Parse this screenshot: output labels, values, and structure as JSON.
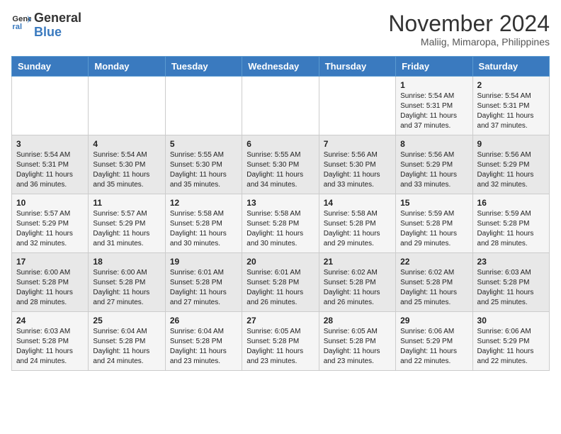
{
  "header": {
    "logo_general": "General",
    "logo_blue": "Blue",
    "month_year": "November 2024",
    "location": "Maliig, Mimaropa, Philippines"
  },
  "calendar": {
    "days_of_week": [
      "Sunday",
      "Monday",
      "Tuesday",
      "Wednesday",
      "Thursday",
      "Friday",
      "Saturday"
    ],
    "weeks": [
      [
        {
          "day": "",
          "info": ""
        },
        {
          "day": "",
          "info": ""
        },
        {
          "day": "",
          "info": ""
        },
        {
          "day": "",
          "info": ""
        },
        {
          "day": "",
          "info": ""
        },
        {
          "day": "1",
          "info": "Sunrise: 5:54 AM\nSunset: 5:31 PM\nDaylight: 11 hours\nand 37 minutes."
        },
        {
          "day": "2",
          "info": "Sunrise: 5:54 AM\nSunset: 5:31 PM\nDaylight: 11 hours\nand 37 minutes."
        }
      ],
      [
        {
          "day": "3",
          "info": "Sunrise: 5:54 AM\nSunset: 5:31 PM\nDaylight: 11 hours\nand 36 minutes."
        },
        {
          "day": "4",
          "info": "Sunrise: 5:54 AM\nSunset: 5:30 PM\nDaylight: 11 hours\nand 35 minutes."
        },
        {
          "day": "5",
          "info": "Sunrise: 5:55 AM\nSunset: 5:30 PM\nDaylight: 11 hours\nand 35 minutes."
        },
        {
          "day": "6",
          "info": "Sunrise: 5:55 AM\nSunset: 5:30 PM\nDaylight: 11 hours\nand 34 minutes."
        },
        {
          "day": "7",
          "info": "Sunrise: 5:56 AM\nSunset: 5:30 PM\nDaylight: 11 hours\nand 33 minutes."
        },
        {
          "day": "8",
          "info": "Sunrise: 5:56 AM\nSunset: 5:29 PM\nDaylight: 11 hours\nand 33 minutes."
        },
        {
          "day": "9",
          "info": "Sunrise: 5:56 AM\nSunset: 5:29 PM\nDaylight: 11 hours\nand 32 minutes."
        }
      ],
      [
        {
          "day": "10",
          "info": "Sunrise: 5:57 AM\nSunset: 5:29 PM\nDaylight: 11 hours\nand 32 minutes."
        },
        {
          "day": "11",
          "info": "Sunrise: 5:57 AM\nSunset: 5:29 PM\nDaylight: 11 hours\nand 31 minutes."
        },
        {
          "day": "12",
          "info": "Sunrise: 5:58 AM\nSunset: 5:28 PM\nDaylight: 11 hours\nand 30 minutes."
        },
        {
          "day": "13",
          "info": "Sunrise: 5:58 AM\nSunset: 5:28 PM\nDaylight: 11 hours\nand 30 minutes."
        },
        {
          "day": "14",
          "info": "Sunrise: 5:58 AM\nSunset: 5:28 PM\nDaylight: 11 hours\nand 29 minutes."
        },
        {
          "day": "15",
          "info": "Sunrise: 5:59 AM\nSunset: 5:28 PM\nDaylight: 11 hours\nand 29 minutes."
        },
        {
          "day": "16",
          "info": "Sunrise: 5:59 AM\nSunset: 5:28 PM\nDaylight: 11 hours\nand 28 minutes."
        }
      ],
      [
        {
          "day": "17",
          "info": "Sunrise: 6:00 AM\nSunset: 5:28 PM\nDaylight: 11 hours\nand 28 minutes."
        },
        {
          "day": "18",
          "info": "Sunrise: 6:00 AM\nSunset: 5:28 PM\nDaylight: 11 hours\nand 27 minutes."
        },
        {
          "day": "19",
          "info": "Sunrise: 6:01 AM\nSunset: 5:28 PM\nDaylight: 11 hours\nand 27 minutes."
        },
        {
          "day": "20",
          "info": "Sunrise: 6:01 AM\nSunset: 5:28 PM\nDaylight: 11 hours\nand 26 minutes."
        },
        {
          "day": "21",
          "info": "Sunrise: 6:02 AM\nSunset: 5:28 PM\nDaylight: 11 hours\nand 26 minutes."
        },
        {
          "day": "22",
          "info": "Sunrise: 6:02 AM\nSunset: 5:28 PM\nDaylight: 11 hours\nand 25 minutes."
        },
        {
          "day": "23",
          "info": "Sunrise: 6:03 AM\nSunset: 5:28 PM\nDaylight: 11 hours\nand 25 minutes."
        }
      ],
      [
        {
          "day": "24",
          "info": "Sunrise: 6:03 AM\nSunset: 5:28 PM\nDaylight: 11 hours\nand 24 minutes."
        },
        {
          "day": "25",
          "info": "Sunrise: 6:04 AM\nSunset: 5:28 PM\nDaylight: 11 hours\nand 24 minutes."
        },
        {
          "day": "26",
          "info": "Sunrise: 6:04 AM\nSunset: 5:28 PM\nDaylight: 11 hours\nand 23 minutes."
        },
        {
          "day": "27",
          "info": "Sunrise: 6:05 AM\nSunset: 5:28 PM\nDaylight: 11 hours\nand 23 minutes."
        },
        {
          "day": "28",
          "info": "Sunrise: 6:05 AM\nSunset: 5:28 PM\nDaylight: 11 hours\nand 23 minutes."
        },
        {
          "day": "29",
          "info": "Sunrise: 6:06 AM\nSunset: 5:29 PM\nDaylight: 11 hours\nand 22 minutes."
        },
        {
          "day": "30",
          "info": "Sunrise: 6:06 AM\nSunset: 5:29 PM\nDaylight: 11 hours\nand 22 minutes."
        }
      ]
    ]
  }
}
